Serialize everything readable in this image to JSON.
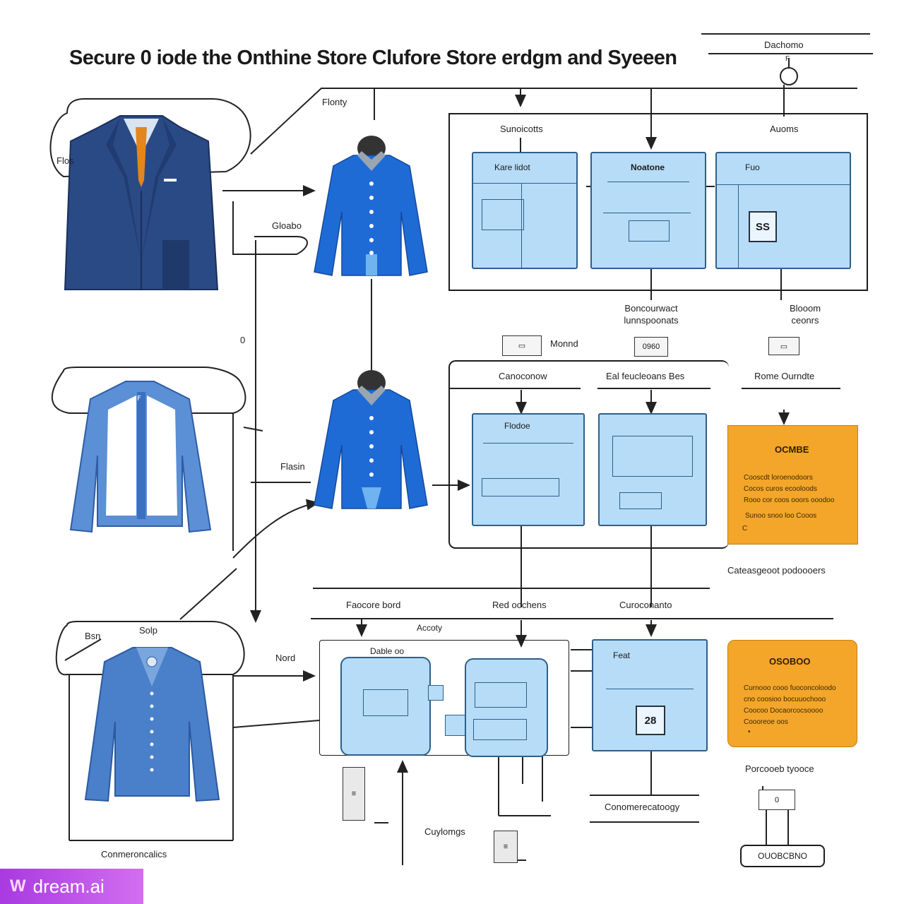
{
  "title": "Secure 0 iode the Onthine Store Clufore Store erdgm and Syeeen",
  "labels": {
    "top_right": "Dachomo",
    "top_right_f": "F",
    "flow_top": "Flonty",
    "suit_tag": "Flos",
    "grow": "Gloabo",
    "circle_mark": "0",
    "mid_left": "Flasin",
    "bottom_left_a": "Bsn",
    "bottom_left_b": "Solp",
    "bottom_mid": "Nord",
    "caption_left": "Conmeroncalics",
    "caption_mid": "Cuylomgs",
    "sec1_left": "Sunoicotts",
    "sec1_right": "Auoms",
    "conn_mid": "Boncourwact\nlunnspoonats",
    "conn_right": "Blooom\nceonrs",
    "monitor_label": "Monnd",
    "sec2_a": "Canoconow",
    "sec2_b": "Eal feucleoans Bes",
    "sec2_c": "Rome Ourndte",
    "cat_label": "Cateasgeoot podoooers",
    "row3_a": "Faocore bord",
    "row3_b": "Red oochens",
    "row3_c": "Curoconanto",
    "row3_small": "Accoty",
    "bottom_right_label": "Porcooeb tyooce",
    "bottom_bar_label": "Conomerecatoogy",
    "bottom_pill": "OUOBCBNO"
  },
  "panels": {
    "p1": {
      "title": "Kare lidot"
    },
    "p2": {
      "title": "Noatone"
    },
    "p3": {
      "title": "Fuo",
      "badge": "SS"
    },
    "p4": {
      "title": "Flodoe"
    },
    "p5": {
      "title": ""
    },
    "p6": {
      "title": "Dable oo"
    },
    "p7": {
      "title": ""
    },
    "p8": {
      "title": "Feat",
      "badge": "28"
    }
  },
  "orange_boxes": [
    {
      "title": "OCMBE",
      "lines": [
        "Cooscdt loroenodoors",
        "Cocos curos ecooloods",
        "Rooo cor coos ooors ooodoo",
        "Sunoo snoo loo Cooos",
        "C"
      ]
    },
    {
      "title": "OSOBOO",
      "lines": [
        "Curnooo cooo fuoconcoloodo",
        "cno coosioo bocuuochooo",
        "Coocoo Docaorcocsoooo",
        "Coooreoe oos",
        "•"
      ]
    }
  ],
  "badges": {
    "b1": "0960",
    "b2": "0"
  },
  "watermark": {
    "mark": "W",
    "text": "dream.ai"
  },
  "colors": {
    "panel": "#b7dcf7",
    "panel_border": "#2d5f8a",
    "accent_orange": "#f4a62a",
    "garment_blue": "#1f6bd6",
    "suit_navy": "#2a4a86"
  }
}
